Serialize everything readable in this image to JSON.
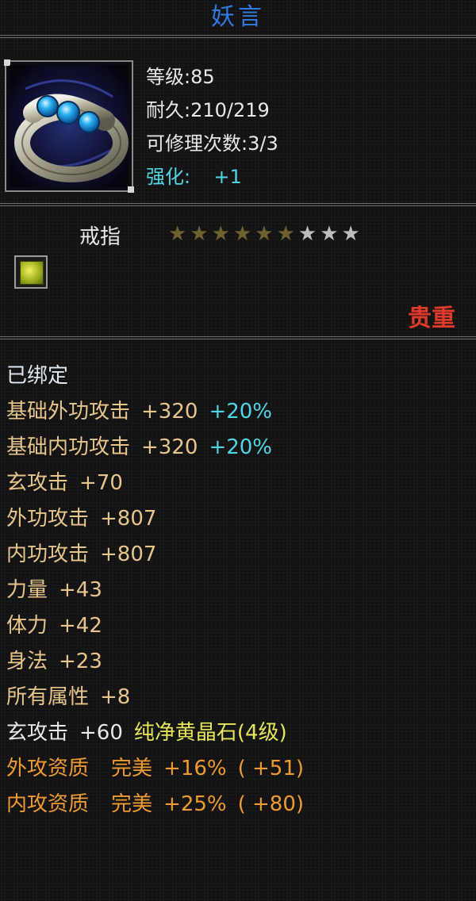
{
  "item": {
    "name": "妖言",
    "level": "等级:85",
    "durability": "耐久:210/219",
    "repairs": "可修理次数:3/3",
    "enhance_label": "强化:",
    "enhance_value": "+1",
    "type": "戒指",
    "stars_filled": 6,
    "stars_total": 9,
    "rarity": "贵重"
  },
  "attributes": {
    "bound": "已绑定",
    "base_ext_label": "基础外功攻击",
    "base_ext_value": "+320",
    "base_ext_pct": "+20%",
    "base_int_label": "基础内功攻击",
    "base_int_value": "+320",
    "base_int_pct": "+20%",
    "xuan_label": "玄攻击",
    "xuan_value": "+70",
    "ext_label": "外功攻击",
    "ext_value": "+807",
    "int_label": "内功攻击",
    "int_value": "+807",
    "str_label": "力量",
    "str_value": "+43",
    "vit_label": "体力",
    "vit_value": "+42",
    "agi_label": "身法",
    "agi_value": "+23",
    "all_label": "所有属性",
    "all_value": "+8",
    "gem_xuan_label": "玄攻击",
    "gem_xuan_value": "+60",
    "gem_name": "纯净黄晶石(4级)",
    "ext_apt_label": "外攻资质",
    "ext_apt_grade": "完美",
    "ext_apt_pct": "+16%",
    "ext_apt_bonus": "( +51)",
    "int_apt_label": "内攻资质",
    "int_apt_grade": "完美",
    "int_apt_pct": "+25%",
    "int_apt_bonus": "( +80)"
  },
  "colors": {
    "title": "#2f7be0",
    "rarity": "#e03a2a",
    "enhance": "#4fd6e6",
    "aptitude": "#f09a32",
    "gem": "#e6e65a"
  },
  "icons": {
    "item": "ring-icon",
    "gem": "topaz-gem-icon",
    "star": "star-icon"
  }
}
